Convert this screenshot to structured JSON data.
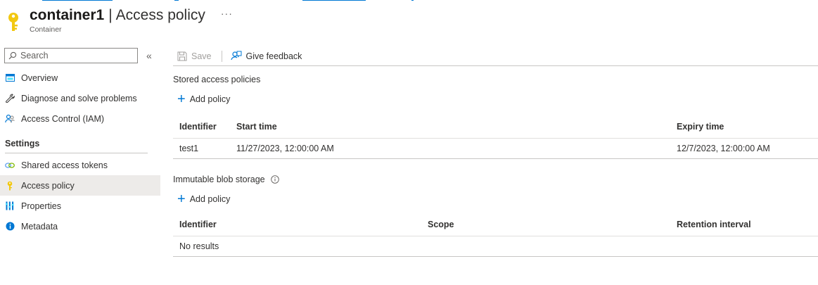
{
  "header": {
    "title": "container1",
    "separator": "|",
    "page": "Access policy",
    "more": "···",
    "subtitle": "Container"
  },
  "sidebar": {
    "search_placeholder": "Search",
    "collapse_glyph": "«",
    "items": [
      {
        "label": "Overview",
        "icon": "overview-icon"
      },
      {
        "label": "Diagnose and solve problems",
        "icon": "wrench-icon"
      },
      {
        "label": "Access Control (IAM)",
        "icon": "people-icon"
      }
    ],
    "settings_header": "Settings",
    "settings_items": [
      {
        "label": "Shared access tokens",
        "icon": "link-icon"
      },
      {
        "label": "Access policy",
        "icon": "key-icon",
        "active": true
      },
      {
        "label": "Properties",
        "icon": "properties-icon"
      },
      {
        "label": "Metadata",
        "icon": "info-icon"
      }
    ]
  },
  "toolbar": {
    "save": "Save",
    "feedback": "Give feedback"
  },
  "stored_policies": {
    "title": "Stored access policies",
    "add_label": "Add policy",
    "columns": [
      "Identifier",
      "Start time",
      "Expiry time"
    ],
    "rows": [
      [
        "test1",
        "11/27/2023, 12:00:00 AM",
        "12/7/2023, 12:00:00 AM"
      ]
    ]
  },
  "immutable": {
    "title": "Immutable blob storage",
    "add_label": "Add policy",
    "columns": [
      "Identifier",
      "Scope",
      "Retention interval"
    ],
    "empty": "No results"
  },
  "colors": {
    "accent": "#0078d4",
    "key_yellow": "#f2c811",
    "active_bg": "#edebe9"
  }
}
